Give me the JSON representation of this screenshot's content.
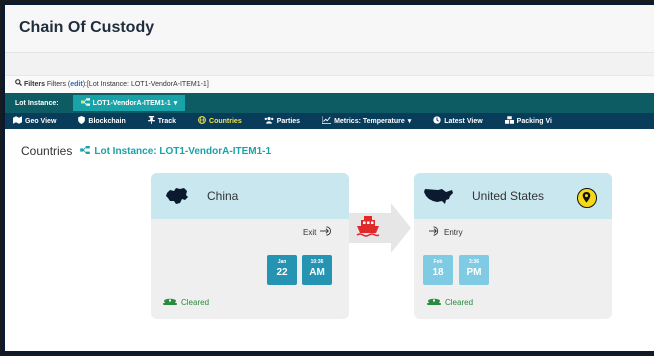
{
  "page": {
    "title": "Chain Of Custody"
  },
  "filters": {
    "prefix": "Filters (",
    "edit": "edit",
    "suffix": "):[Lot Instance: LOT1-VendorA-ITEM1-1]"
  },
  "lot_bar": {
    "label": "Lot Instance:",
    "selected": "LOT1-VendorA-ITEM1-1"
  },
  "nav": {
    "items": [
      {
        "label": "Geo View",
        "icon": "map-icon"
      },
      {
        "label": "Blockchain",
        "icon": "shield-icon"
      },
      {
        "label": "Track",
        "icon": "pin-icon"
      },
      {
        "label": "Countries",
        "icon": "globe-icon",
        "active": true
      },
      {
        "label": "Parties",
        "icon": "users-icon"
      },
      {
        "label": "Metrics: Temperature",
        "icon": "line-chart-icon"
      },
      {
        "label": "Latest View",
        "icon": "clock-icon"
      },
      {
        "label": "Packing Vi",
        "icon": "boxes-icon"
      }
    ]
  },
  "section": {
    "heading": "Countries",
    "lot_label": "Lot Instance: LOT1-VendorA-ITEM1-1"
  },
  "cards": [
    {
      "country": "China",
      "direction": "Exit",
      "date_month": "Jan",
      "date_day": "22",
      "time_small": "10:36",
      "time_large": "AM",
      "status": "Cleared"
    },
    {
      "country": "United States",
      "direction": "Entry",
      "date_month": "Feb",
      "date_day": "18",
      "time_small": "3:36",
      "time_large": "PM",
      "status": "Cleared"
    }
  ],
  "colors": {
    "nav_bg": "#083c5a",
    "lot_bar_bg": "#0d5c63",
    "accent_teal": "#19a3a8",
    "active_nav": "#f2e34c",
    "card_header": "#c9e7ef",
    "cleared_green": "#2a8a3d",
    "ship_red": "#e0292d"
  }
}
